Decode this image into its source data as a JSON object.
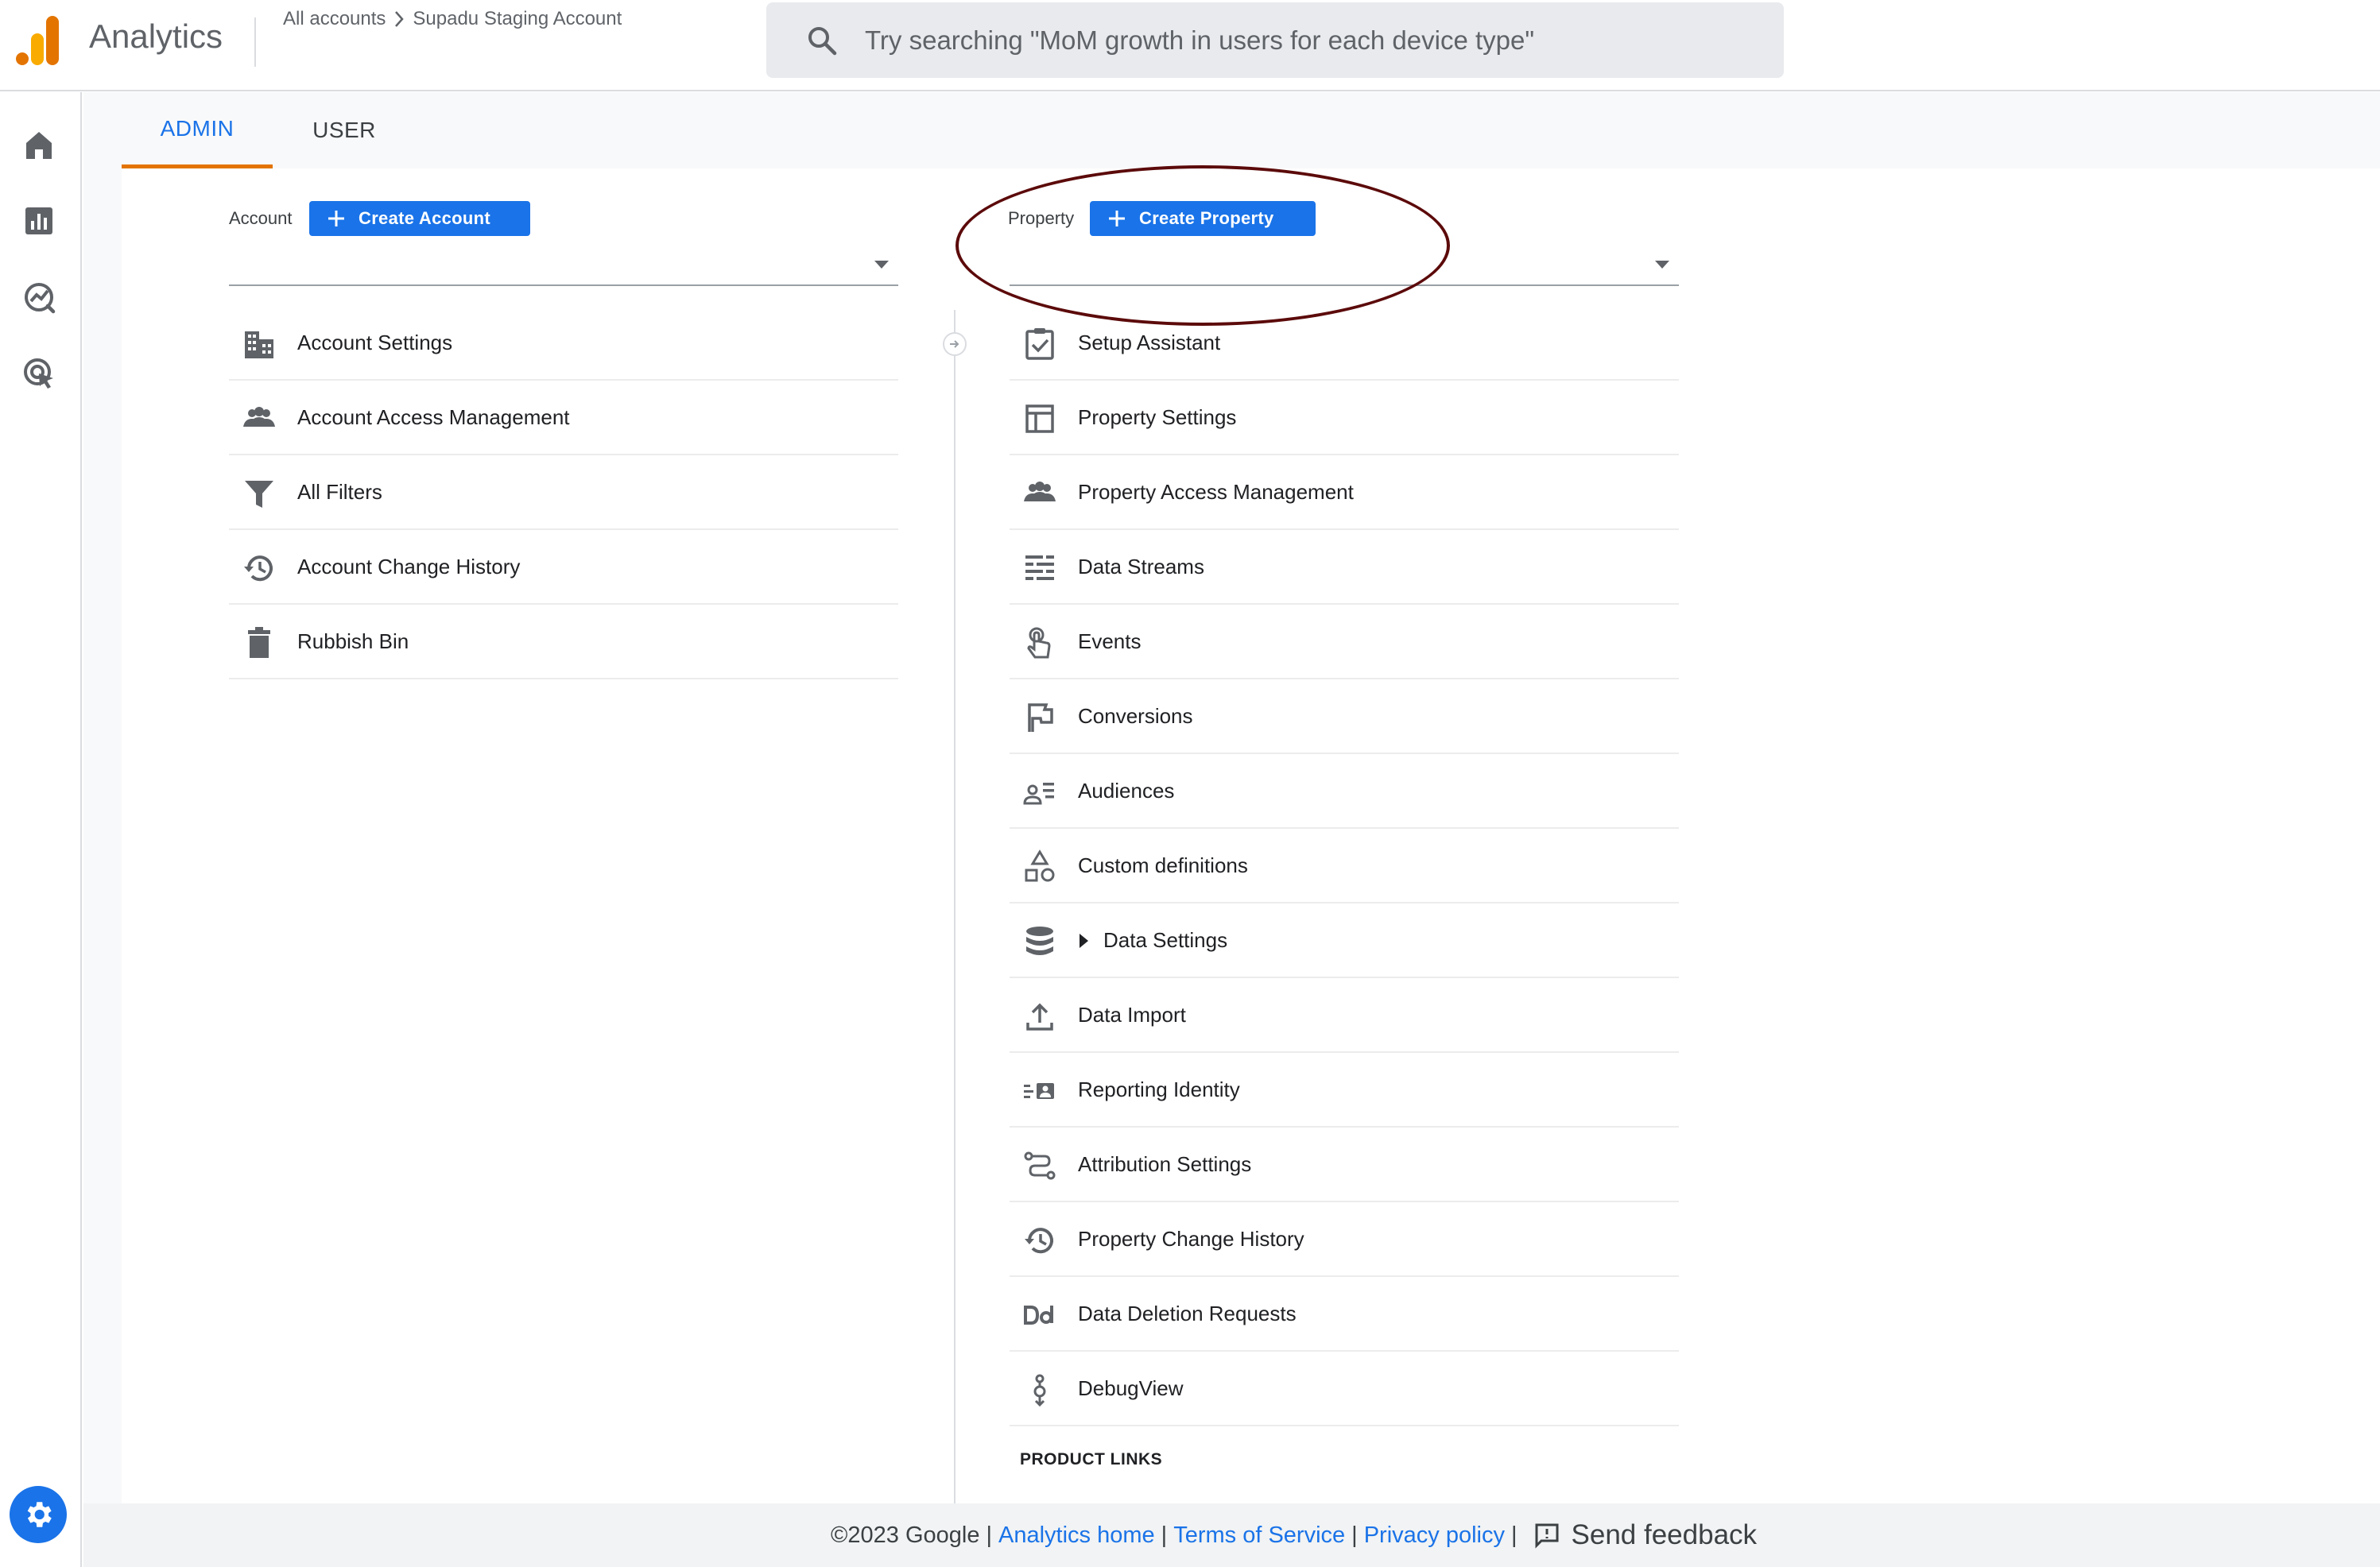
{
  "app": {
    "title": "Analytics"
  },
  "breadcrumb": {
    "root": "All accounts",
    "current": "Supadu Staging Account"
  },
  "search": {
    "placeholder": "Try searching \"MoM growth in users for each device type\""
  },
  "tabs": [
    {
      "label": "ADMIN",
      "active": true
    },
    {
      "label": "USER",
      "active": false
    }
  ],
  "account": {
    "label": "Account",
    "create_label": "Create Account",
    "items": [
      {
        "label": "Account Settings",
        "icon": "building-icon"
      },
      {
        "label": "Account Access Management",
        "icon": "people-icon"
      },
      {
        "label": "All Filters",
        "icon": "filter-icon"
      },
      {
        "label": "Account Change History",
        "icon": "history-icon"
      },
      {
        "label": "Rubbish Bin",
        "icon": "trash-icon"
      }
    ]
  },
  "property": {
    "label": "Property",
    "create_label": "Create Property",
    "items": [
      {
        "label": "Setup Assistant",
        "icon": "checklist-icon"
      },
      {
        "label": "Property Settings",
        "icon": "layout-icon"
      },
      {
        "label": "Property Access Management",
        "icon": "people-icon"
      },
      {
        "label": "Data Streams",
        "icon": "streams-icon"
      },
      {
        "label": "Events",
        "icon": "touch-icon"
      },
      {
        "label": "Conversions",
        "icon": "flag-icon"
      },
      {
        "label": "Audiences",
        "icon": "audience-icon"
      },
      {
        "label": "Custom definitions",
        "icon": "shapes-icon"
      },
      {
        "label": "Data Settings",
        "icon": "database-icon"
      },
      {
        "label": "Data Import",
        "icon": "upload-icon"
      },
      {
        "label": "Reporting Identity",
        "icon": "identity-icon"
      },
      {
        "label": "Attribution Settings",
        "icon": "attribution-icon"
      },
      {
        "label": "Property Change History",
        "icon": "history-icon"
      },
      {
        "label": "Data Deletion Requests",
        "icon": "dd-icon"
      },
      {
        "label": "DebugView",
        "icon": "debug-icon"
      }
    ],
    "section_header": "PRODUCT LINKS"
  },
  "footer": {
    "copyright": "©2023 Google",
    "links": {
      "home": "Analytics home",
      "terms": "Terms of Service",
      "privacy": "Privacy policy"
    },
    "feedback": "Send feedback"
  },
  "colors": {
    "accent": "#1a73e8",
    "tab_indicator": "#e37400",
    "annotation": "#5c0a0a"
  }
}
